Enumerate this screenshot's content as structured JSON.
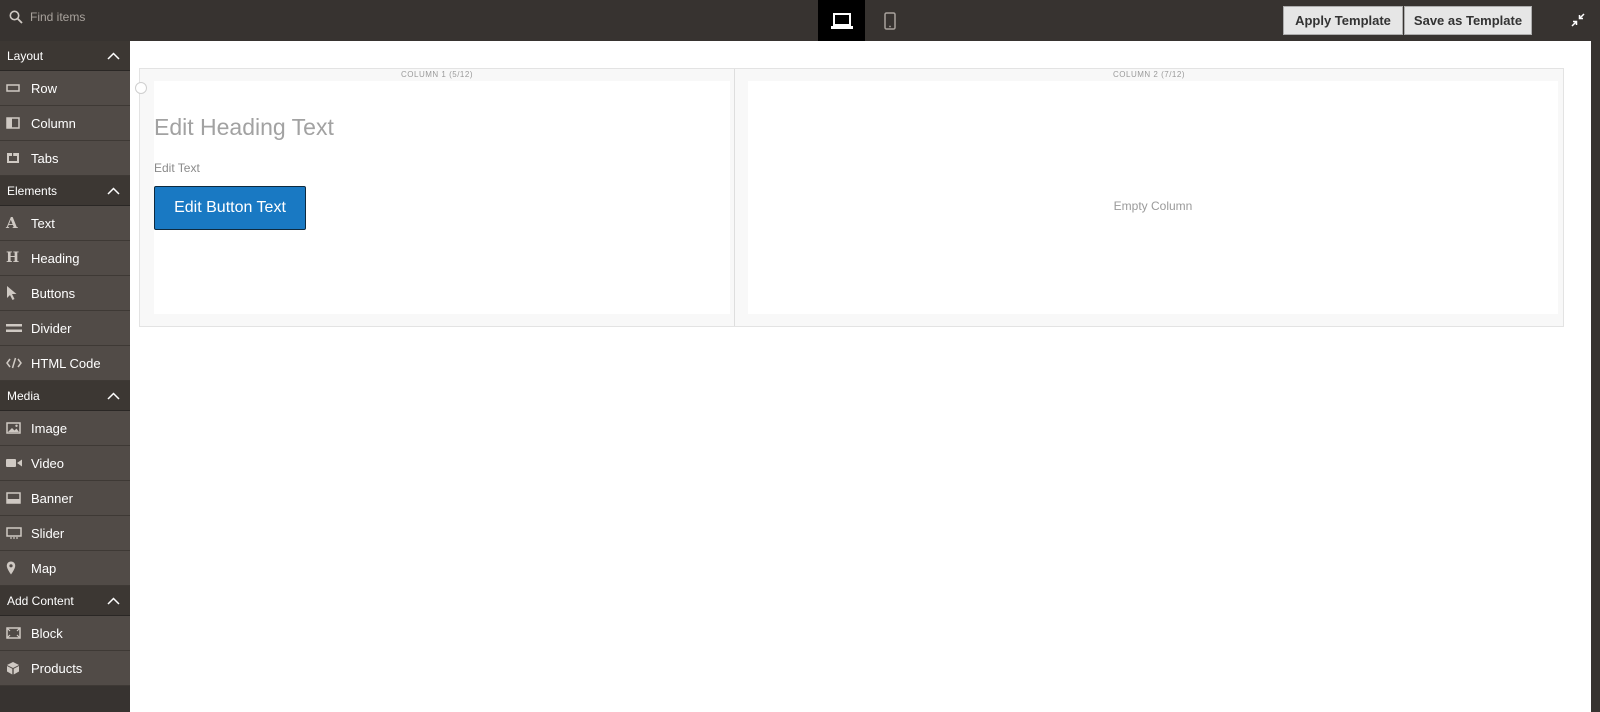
{
  "search": {
    "placeholder": "Find items"
  },
  "toolbar": {
    "apply_template": "Apply Template",
    "save_as_template": "Save as Template"
  },
  "sidebar": {
    "sections": [
      {
        "title": "Layout",
        "items": [
          {
            "label": "Row",
            "icon": "row-icon"
          },
          {
            "label": "Column",
            "icon": "column-icon"
          },
          {
            "label": "Tabs",
            "icon": "tabs-icon"
          }
        ]
      },
      {
        "title": "Elements",
        "items": [
          {
            "label": "Text",
            "icon": "text-icon"
          },
          {
            "label": "Heading",
            "icon": "heading-icon"
          },
          {
            "label": "Buttons",
            "icon": "cursor-icon"
          },
          {
            "label": "Divider",
            "icon": "divider-icon"
          },
          {
            "label": "HTML Code",
            "icon": "code-icon"
          }
        ]
      },
      {
        "title": "Media",
        "items": [
          {
            "label": "Image",
            "icon": "image-icon"
          },
          {
            "label": "Video",
            "icon": "video-icon"
          },
          {
            "label": "Banner",
            "icon": "banner-icon"
          },
          {
            "label": "Slider",
            "icon": "slider-icon"
          },
          {
            "label": "Map",
            "icon": "map-pin-icon"
          }
        ]
      },
      {
        "title": "Add Content",
        "items": [
          {
            "label": "Block",
            "icon": "block-icon"
          },
          {
            "label": "Products",
            "icon": "products-icon"
          }
        ]
      }
    ]
  },
  "stage": {
    "column1": {
      "label": "COLUMN 1 (5/12)",
      "heading": "Edit Heading Text",
      "text": "Edit Text",
      "button": "Edit Button Text"
    },
    "column2": {
      "label": "COLUMN 2 (7/12)",
      "empty": "Empty Column"
    }
  },
  "colors": {
    "panel_dark": "#373330",
    "sidebar_item": "#514b47",
    "button_blue": "#1979c3"
  }
}
